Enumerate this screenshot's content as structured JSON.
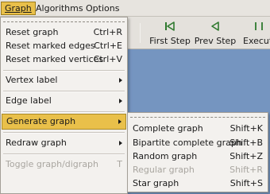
{
  "menubar": {
    "graph": "Graph",
    "algorithms": "Algorithms",
    "options": "Options"
  },
  "toolbar": {
    "first_step": "First Step",
    "prev_step": "Prev Step",
    "execute": "Execut",
    "icons": [
      "first-step-icon",
      "prev-step-icon",
      "execute-icon"
    ]
  },
  "graph_menu": {
    "reset_graph": {
      "label": "Reset graph",
      "shortcut": "Ctrl+R"
    },
    "reset_marked_edges": {
      "label": "Reset marked edges",
      "shortcut": "Ctrl+E"
    },
    "reset_marked_vertices": {
      "label": "Reset marked vertices",
      "shortcut": "Ctrl+V"
    },
    "vertex_label": {
      "label": "Vertex label"
    },
    "edge_label": {
      "label": "Edge label"
    },
    "generate_graph": {
      "label": "Generate graph"
    },
    "redraw_graph": {
      "label": "Redraw graph"
    },
    "toggle_graph_digraph": {
      "label": "Toggle graph/digraph",
      "shortcut": "T"
    }
  },
  "generate_menu": {
    "complete": {
      "label": "Complete graph",
      "shortcut": "Shift+K"
    },
    "bipartite": {
      "label": "Bipartite complete graph",
      "shortcut": "Shift+B"
    },
    "random": {
      "label": "Random graph",
      "shortcut": "Shift+Z"
    },
    "regular": {
      "label": "Regular graph",
      "shortcut": "Shift+R"
    },
    "star": {
      "label": "Star graph",
      "shortcut": "Shift+S"
    }
  },
  "colors": {
    "highlight": "#e9c04a",
    "canvas": "#7595c0",
    "menu_bg": "#f3f1ee",
    "icon_green": "#2f7a2f"
  }
}
